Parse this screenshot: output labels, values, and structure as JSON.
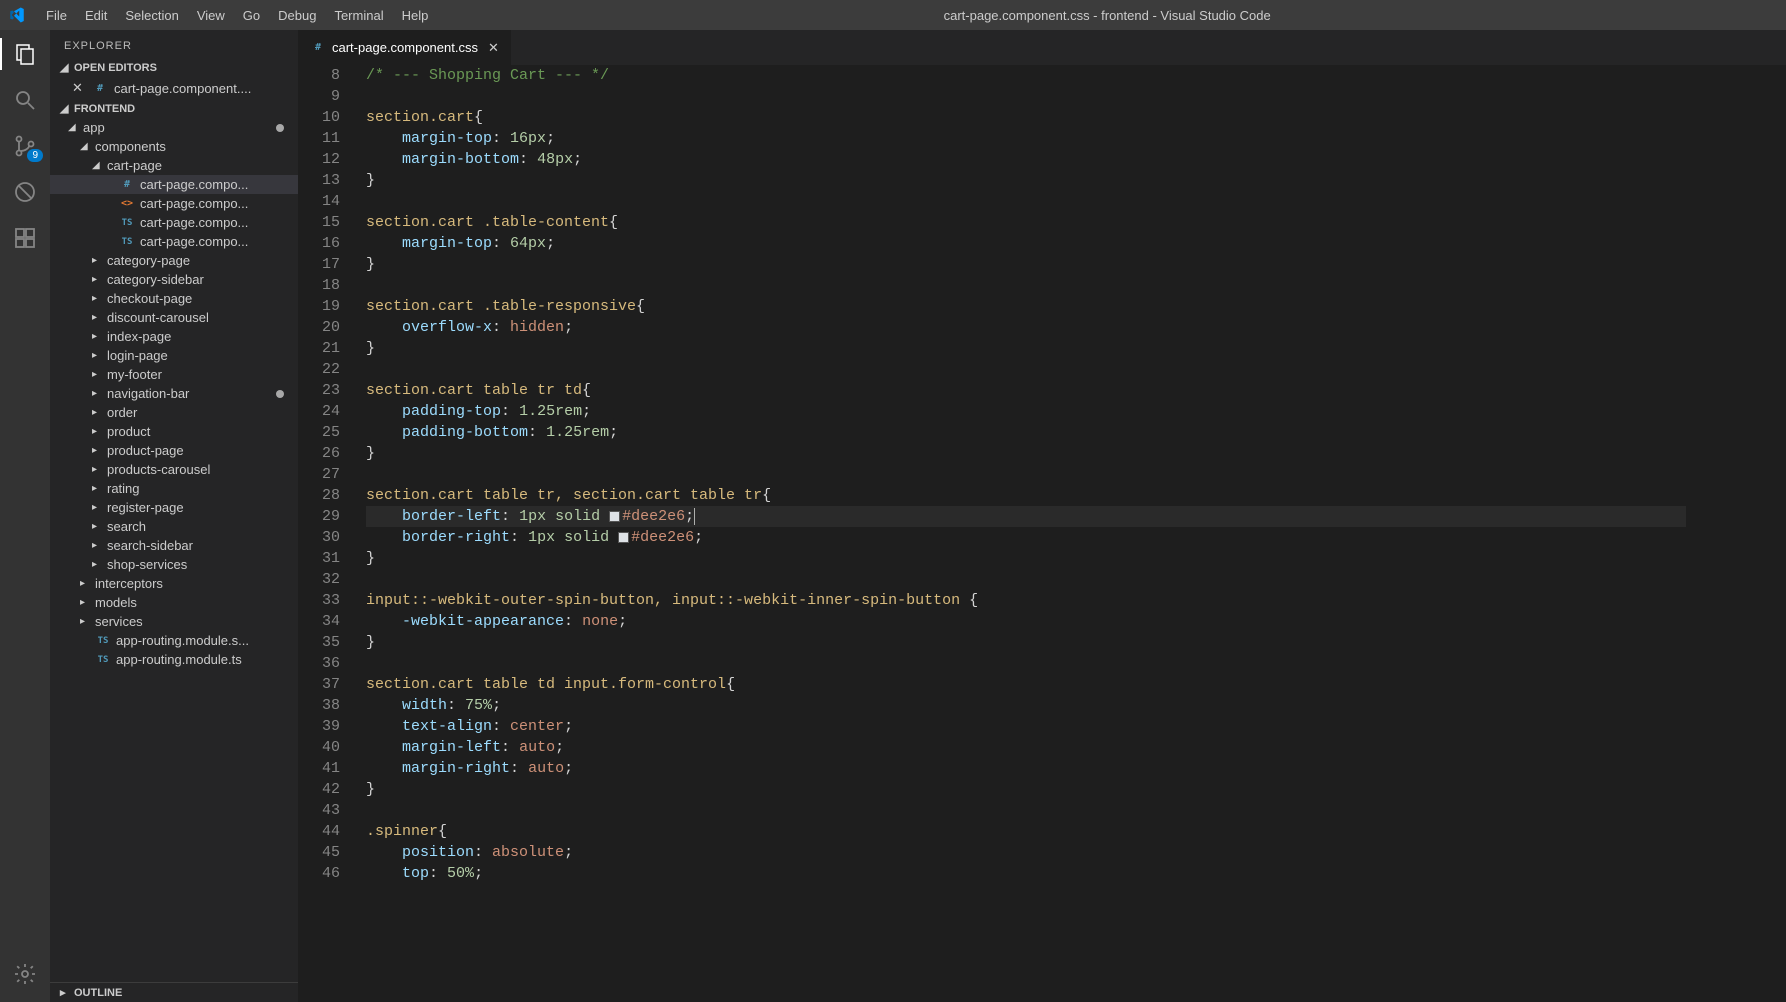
{
  "titlebar": {
    "menus": [
      "File",
      "Edit",
      "Selection",
      "View",
      "Go",
      "Debug",
      "Terminal",
      "Help"
    ],
    "title": "cart-page.component.css - frontend - Visual Studio Code"
  },
  "activitybar": {
    "scm_badge": "9"
  },
  "sidebar": {
    "title": "EXPLORER",
    "open_editors_label": "OPEN EDITORS",
    "open_editor_file": "cart-page.component....",
    "project_label": "FRONTEND",
    "outline_label": "OUTLINE",
    "tree": [
      {
        "label": "app",
        "indent": 0,
        "kind": "folder-open",
        "dot": true
      },
      {
        "label": "components",
        "indent": 1,
        "kind": "folder-open"
      },
      {
        "label": "cart-page",
        "indent": 2,
        "kind": "folder-open"
      },
      {
        "label": "cart-page.compo...",
        "indent": 3,
        "kind": "file-css",
        "selected": true
      },
      {
        "label": "cart-page.compo...",
        "indent": 3,
        "kind": "file-html"
      },
      {
        "label": "cart-page.compo...",
        "indent": 3,
        "kind": "file-ts"
      },
      {
        "label": "cart-page.compo...",
        "indent": 3,
        "kind": "file-ts"
      },
      {
        "label": "category-page",
        "indent": 2,
        "kind": "folder"
      },
      {
        "label": "category-sidebar",
        "indent": 2,
        "kind": "folder"
      },
      {
        "label": "checkout-page",
        "indent": 2,
        "kind": "folder"
      },
      {
        "label": "discount-carousel",
        "indent": 2,
        "kind": "folder"
      },
      {
        "label": "index-page",
        "indent": 2,
        "kind": "folder"
      },
      {
        "label": "login-page",
        "indent": 2,
        "kind": "folder"
      },
      {
        "label": "my-footer",
        "indent": 2,
        "kind": "folder"
      },
      {
        "label": "navigation-bar",
        "indent": 2,
        "kind": "folder",
        "dot": true
      },
      {
        "label": "order",
        "indent": 2,
        "kind": "folder"
      },
      {
        "label": "product",
        "indent": 2,
        "kind": "folder"
      },
      {
        "label": "product-page",
        "indent": 2,
        "kind": "folder"
      },
      {
        "label": "products-carousel",
        "indent": 2,
        "kind": "folder"
      },
      {
        "label": "rating",
        "indent": 2,
        "kind": "folder"
      },
      {
        "label": "register-page",
        "indent": 2,
        "kind": "folder"
      },
      {
        "label": "search",
        "indent": 2,
        "kind": "folder"
      },
      {
        "label": "search-sidebar",
        "indent": 2,
        "kind": "folder"
      },
      {
        "label": "shop-services",
        "indent": 2,
        "kind": "folder"
      },
      {
        "label": "interceptors",
        "indent": 1,
        "kind": "folder"
      },
      {
        "label": "models",
        "indent": 1,
        "kind": "folder"
      },
      {
        "label": "services",
        "indent": 1,
        "kind": "folder"
      },
      {
        "label": "app-routing.module.s...",
        "indent": 1,
        "kind": "file-ts"
      },
      {
        "label": "app-routing.module.ts",
        "indent": 1,
        "kind": "file-ts"
      }
    ]
  },
  "editor": {
    "tab_label": "cart-page.component.css",
    "first_line_no": 8,
    "lines": [
      {
        "t": "comment",
        "raw": "/* --- Shopping Cart --- */"
      },
      {
        "t": "blank"
      },
      {
        "t": "selector",
        "raw": "section.cart{"
      },
      {
        "t": "decl",
        "prop": "margin-top",
        "val": "16px"
      },
      {
        "t": "decl",
        "prop": "margin-bottom",
        "val": "48px"
      },
      {
        "t": "close"
      },
      {
        "t": "blank"
      },
      {
        "t": "selector",
        "raw": "section.cart .table-content{"
      },
      {
        "t": "decl",
        "prop": "margin-top",
        "val": "64px"
      },
      {
        "t": "close"
      },
      {
        "t": "blank"
      },
      {
        "t": "selector",
        "raw": "section.cart .table-responsive{"
      },
      {
        "t": "decl",
        "prop": "overflow-x",
        "val": "hidden",
        "valcolor": "val"
      },
      {
        "t": "close"
      },
      {
        "t": "blank"
      },
      {
        "t": "selector",
        "raw": "section.cart table tr td{"
      },
      {
        "t": "decl",
        "prop": "padding-top",
        "val": "1.25rem"
      },
      {
        "t": "decl",
        "prop": "padding-bottom",
        "val": "1.25rem"
      },
      {
        "t": "close"
      },
      {
        "t": "blank"
      },
      {
        "t": "selector",
        "raw": "section.cart table tr, section.cart table tr{"
      },
      {
        "t": "decl-color",
        "prop": "border-left",
        "pre": "1px solid ",
        "hex": "#dee2e6",
        "hl": true,
        "cursor": true
      },
      {
        "t": "decl-color",
        "prop": "border-right",
        "pre": "1px solid ",
        "hex": "#dee2e6"
      },
      {
        "t": "close"
      },
      {
        "t": "blank"
      },
      {
        "t": "selector",
        "raw": "input::-webkit-outer-spin-button, input::-webkit-inner-spin-button {"
      },
      {
        "t": "decl",
        "prop": "-webkit-appearance",
        "val": "none",
        "valcolor": "val"
      },
      {
        "t": "close"
      },
      {
        "t": "blank"
      },
      {
        "t": "selector",
        "raw": "section.cart table td input.form-control{"
      },
      {
        "t": "decl",
        "prop": "width",
        "val": "75%"
      },
      {
        "t": "decl",
        "prop": "text-align",
        "val": "center",
        "valcolor": "val"
      },
      {
        "t": "decl",
        "prop": "margin-left",
        "val": "auto",
        "valcolor": "val"
      },
      {
        "t": "decl",
        "prop": "margin-right",
        "val": "auto",
        "valcolor": "val"
      },
      {
        "t": "close"
      },
      {
        "t": "blank"
      },
      {
        "t": "selector",
        "raw": ".spinner{"
      },
      {
        "t": "decl",
        "prop": "position",
        "val": "absolute",
        "valcolor": "val"
      },
      {
        "t": "decl",
        "prop": "top",
        "val": "50%"
      }
    ]
  }
}
